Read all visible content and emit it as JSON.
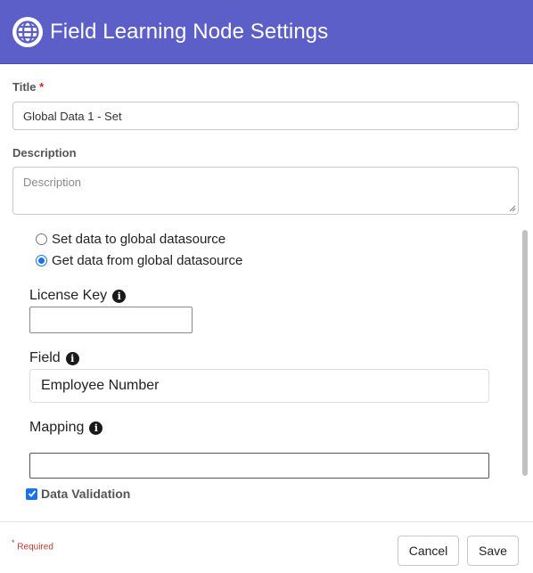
{
  "header": {
    "title": "Field Learning Node Settings",
    "icon": "globe-icon",
    "background": "#5b5fc7"
  },
  "form": {
    "title_label": "Title",
    "required_mark": "*",
    "title_value": "Global Data 1 - Set",
    "description_label": "Description",
    "description_placeholder": "Description"
  },
  "datasource": {
    "options": [
      {
        "label": "Set data to global datasource",
        "selected": false
      },
      {
        "label": "Get data from global datasource",
        "selected": true
      }
    ]
  },
  "license_key": {
    "label": "License Key",
    "value": ""
  },
  "field": {
    "label": "Field",
    "value": "Employee Number"
  },
  "mapping": {
    "label": "Mapping",
    "value": ""
  },
  "data_validation": {
    "label": "Data Validation",
    "checked": true
  },
  "footer": {
    "required_note_mark": "*",
    "required_note": "Required",
    "cancel_label": "Cancel",
    "save_label": "Save"
  },
  "colors": {
    "accent": "#1a73e8",
    "required": "#d22222"
  }
}
